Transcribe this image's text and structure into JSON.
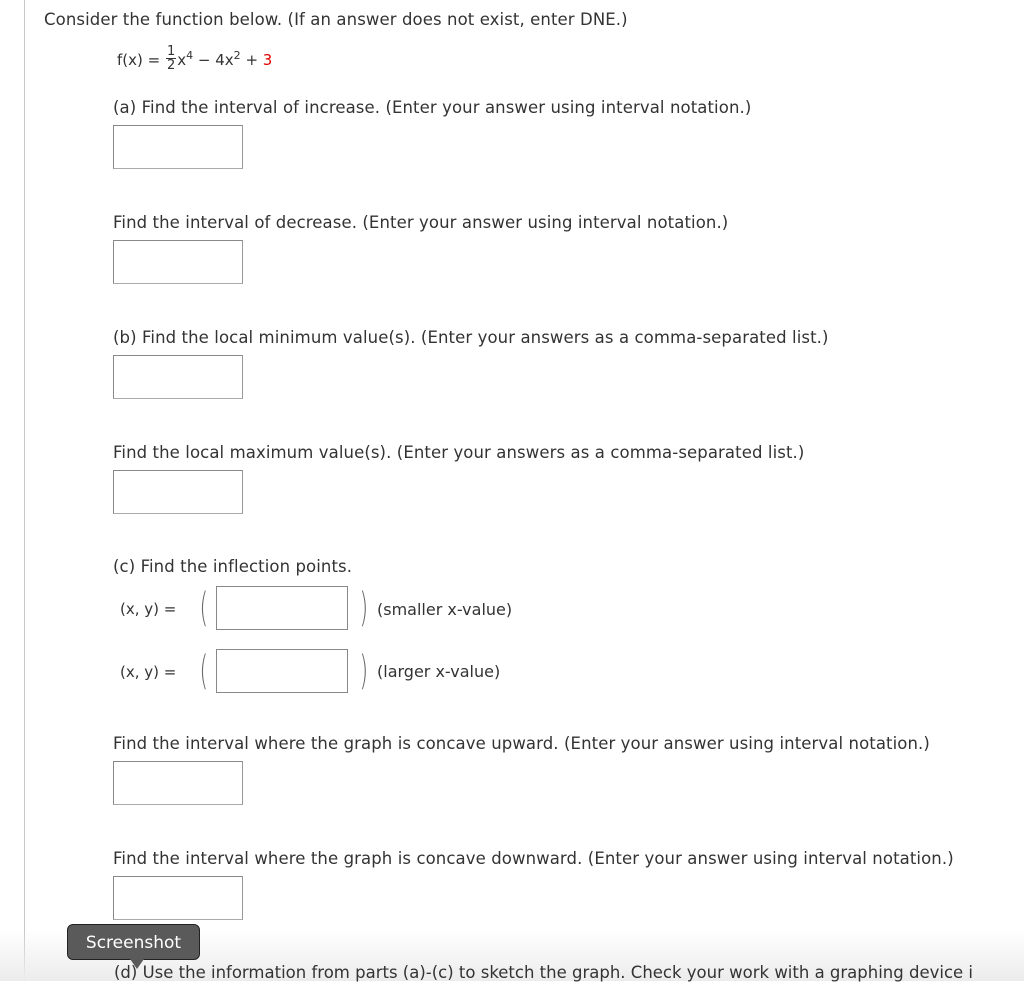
{
  "intro": "Consider the function below. (If an answer does not exist, enter DNE.)",
  "formula": {
    "lhs": "f(x) = ",
    "frac_num": "1",
    "frac_den": "2",
    "term1": "x",
    "term1_exp": "4",
    "term2": " − 4x",
    "term2_exp": "2",
    "plus": " + ",
    "constant": "3"
  },
  "parts": {
    "a_increase": "(a) Find the interval of increase. (Enter your answer using interval notation.)",
    "a_decrease": "Find the interval of decrease. (Enter your answer using interval notation.)",
    "b_min": "(b) Find the local minimum value(s). (Enter your answers as a comma-separated list.)",
    "b_max": "Find the local maximum value(s). (Enter your answers as a comma-separated list.)",
    "c_inflection": "(c) Find the inflection points.",
    "c_xy_label": "(x, y)  =",
    "c_smaller": "(smaller x-value)",
    "c_larger": "(larger x-value)",
    "c_concave_up": "Find the interval where the graph is concave upward. (Enter your answer using interval notation.)",
    "c_concave_down": "Find the interval where the graph is concave downward. (Enter your answer using interval notation.)",
    "d_sketch": "(d) Use the information from parts (a)-(c) to sketch the graph. Check your work with a graphing device i"
  },
  "inputs": {
    "increase": "",
    "decrease": "",
    "local_min": "",
    "local_max": "",
    "inflection_smaller": "",
    "inflection_larger": "",
    "concave_up": "",
    "concave_down": ""
  },
  "tooltip": "Screenshot"
}
